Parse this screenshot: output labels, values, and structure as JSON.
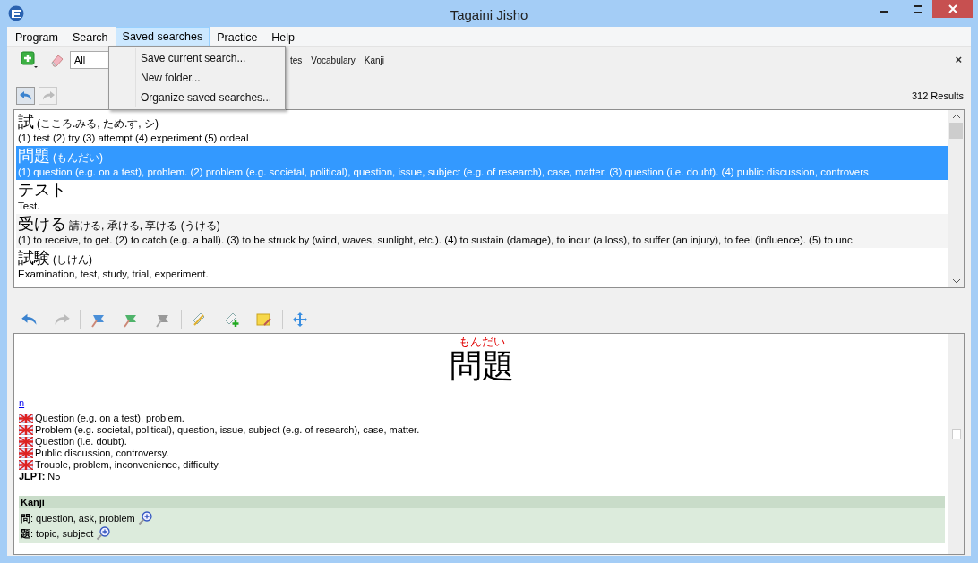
{
  "window": {
    "title": "Tagaini Jisho"
  },
  "menu_bar": [
    {
      "label": "Program",
      "selected": false
    },
    {
      "label": "Search",
      "selected": false
    },
    {
      "label": "Saved searches",
      "selected": true
    },
    {
      "label": "Practice",
      "selected": false
    },
    {
      "label": "Help",
      "selected": false
    }
  ],
  "open_menu": {
    "items": [
      "Save current search...",
      "New folder...",
      "Organize saved searches..."
    ]
  },
  "search_bar": {
    "filter": "All",
    "filter_tabs": [
      "tes",
      "Vocabulary",
      "Kanji"
    ],
    "close": "×"
  },
  "results_count": "312 Results",
  "results": [
    {
      "word": "試",
      "reading": "(こころ.みる, ため.す, シ)",
      "gloss": "(1) test (2) try (3) attempt (4) experiment (5) ordeal",
      "selected": false
    },
    {
      "word": "問題",
      "reading": "(もんだい)",
      "gloss": "(1) question (e.g. on a test), problem. (2) problem (e.g. societal, political), question, issue, subject (e.g. of research), case, matter. (3) question (i.e. doubt). (4) public discussion, controvers",
      "selected": true
    },
    {
      "word": "テスト",
      "gloss": "Test.",
      "selected": false
    },
    {
      "word": "受ける",
      "reading": "請ける, 承ける, 享ける (うける)",
      "gloss": "(1) to receive, to get. (2) to catch (e.g. a ball). (3) to be struck by (wind, waves, sunlight, etc.). (4) to sustain (damage), to incur (a loss), to suffer (an injury), to feel (influence). (5) to unc",
      "selected": false
    },
    {
      "word": "試験",
      "reading": "(しけん)",
      "gloss": "Examination, test, study, trial, experiment.",
      "selected": false
    }
  ],
  "detail": {
    "reading": "もんだい",
    "word": "問題",
    "part_of_speech": "n",
    "senses": [
      "Question (e.g. on a test), problem.",
      "Problem (e.g. societal, political), question, issue, subject (e.g. of research), case, matter.",
      "Question (i.e. doubt).",
      "Public discussion, controversy.",
      "Trouble, problem, inconvenience, difficulty."
    ],
    "jlpt_label": "JLPT:",
    "jlpt": "N5",
    "kanji_section": {
      "title": "Kanji",
      "items": [
        {
          "char": "問",
          "meaning": ": question, ask, problem"
        },
        {
          "char": "題",
          "meaning": ": topic, subject"
        }
      ]
    }
  }
}
